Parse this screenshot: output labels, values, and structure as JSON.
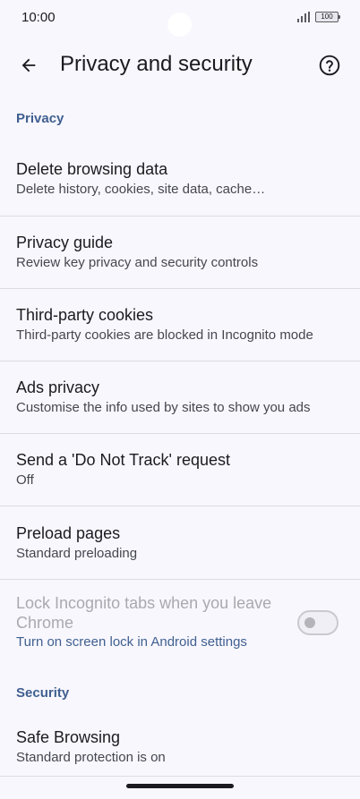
{
  "status_bar": {
    "time": "10:00",
    "battery": "100",
    "signal_icon": "signal-bars-icon"
  },
  "app_bar": {
    "back_icon": "arrow-back-icon",
    "title": "Privacy and security",
    "help_icon": "help-circle-icon"
  },
  "sections": {
    "privacy": {
      "header": "Privacy",
      "items": [
        {
          "title": "Delete browsing data",
          "subtitle": "Delete history, cookies, site data, cache…"
        },
        {
          "title": "Privacy guide",
          "subtitle": "Review key privacy and security controls"
        },
        {
          "title": "Third-party cookies",
          "subtitle": "Third-party cookies are blocked in Incognito mode"
        },
        {
          "title": "Ads privacy",
          "subtitle": "Customise the info used by sites to show you ads"
        },
        {
          "title": "Send a 'Do Not Track' request",
          "subtitle": "Off"
        },
        {
          "title": "Preload pages",
          "subtitle": "Standard preloading"
        }
      ],
      "lock_incognito": {
        "title": "Lock Incognito tabs when you leave Chrome",
        "link": "Turn on screen lock in Android settings",
        "toggle_on": false
      }
    },
    "security": {
      "header": "Security",
      "items": [
        {
          "title": "Safe Browsing",
          "subtitle": "Standard protection is on"
        }
      ]
    }
  },
  "colors": {
    "background": "#f8f7fd",
    "accent": "#3f5f90",
    "text_primary": "#1b1b1f",
    "text_secondary": "#46464f",
    "text_disabled": "#a9a9ae"
  }
}
